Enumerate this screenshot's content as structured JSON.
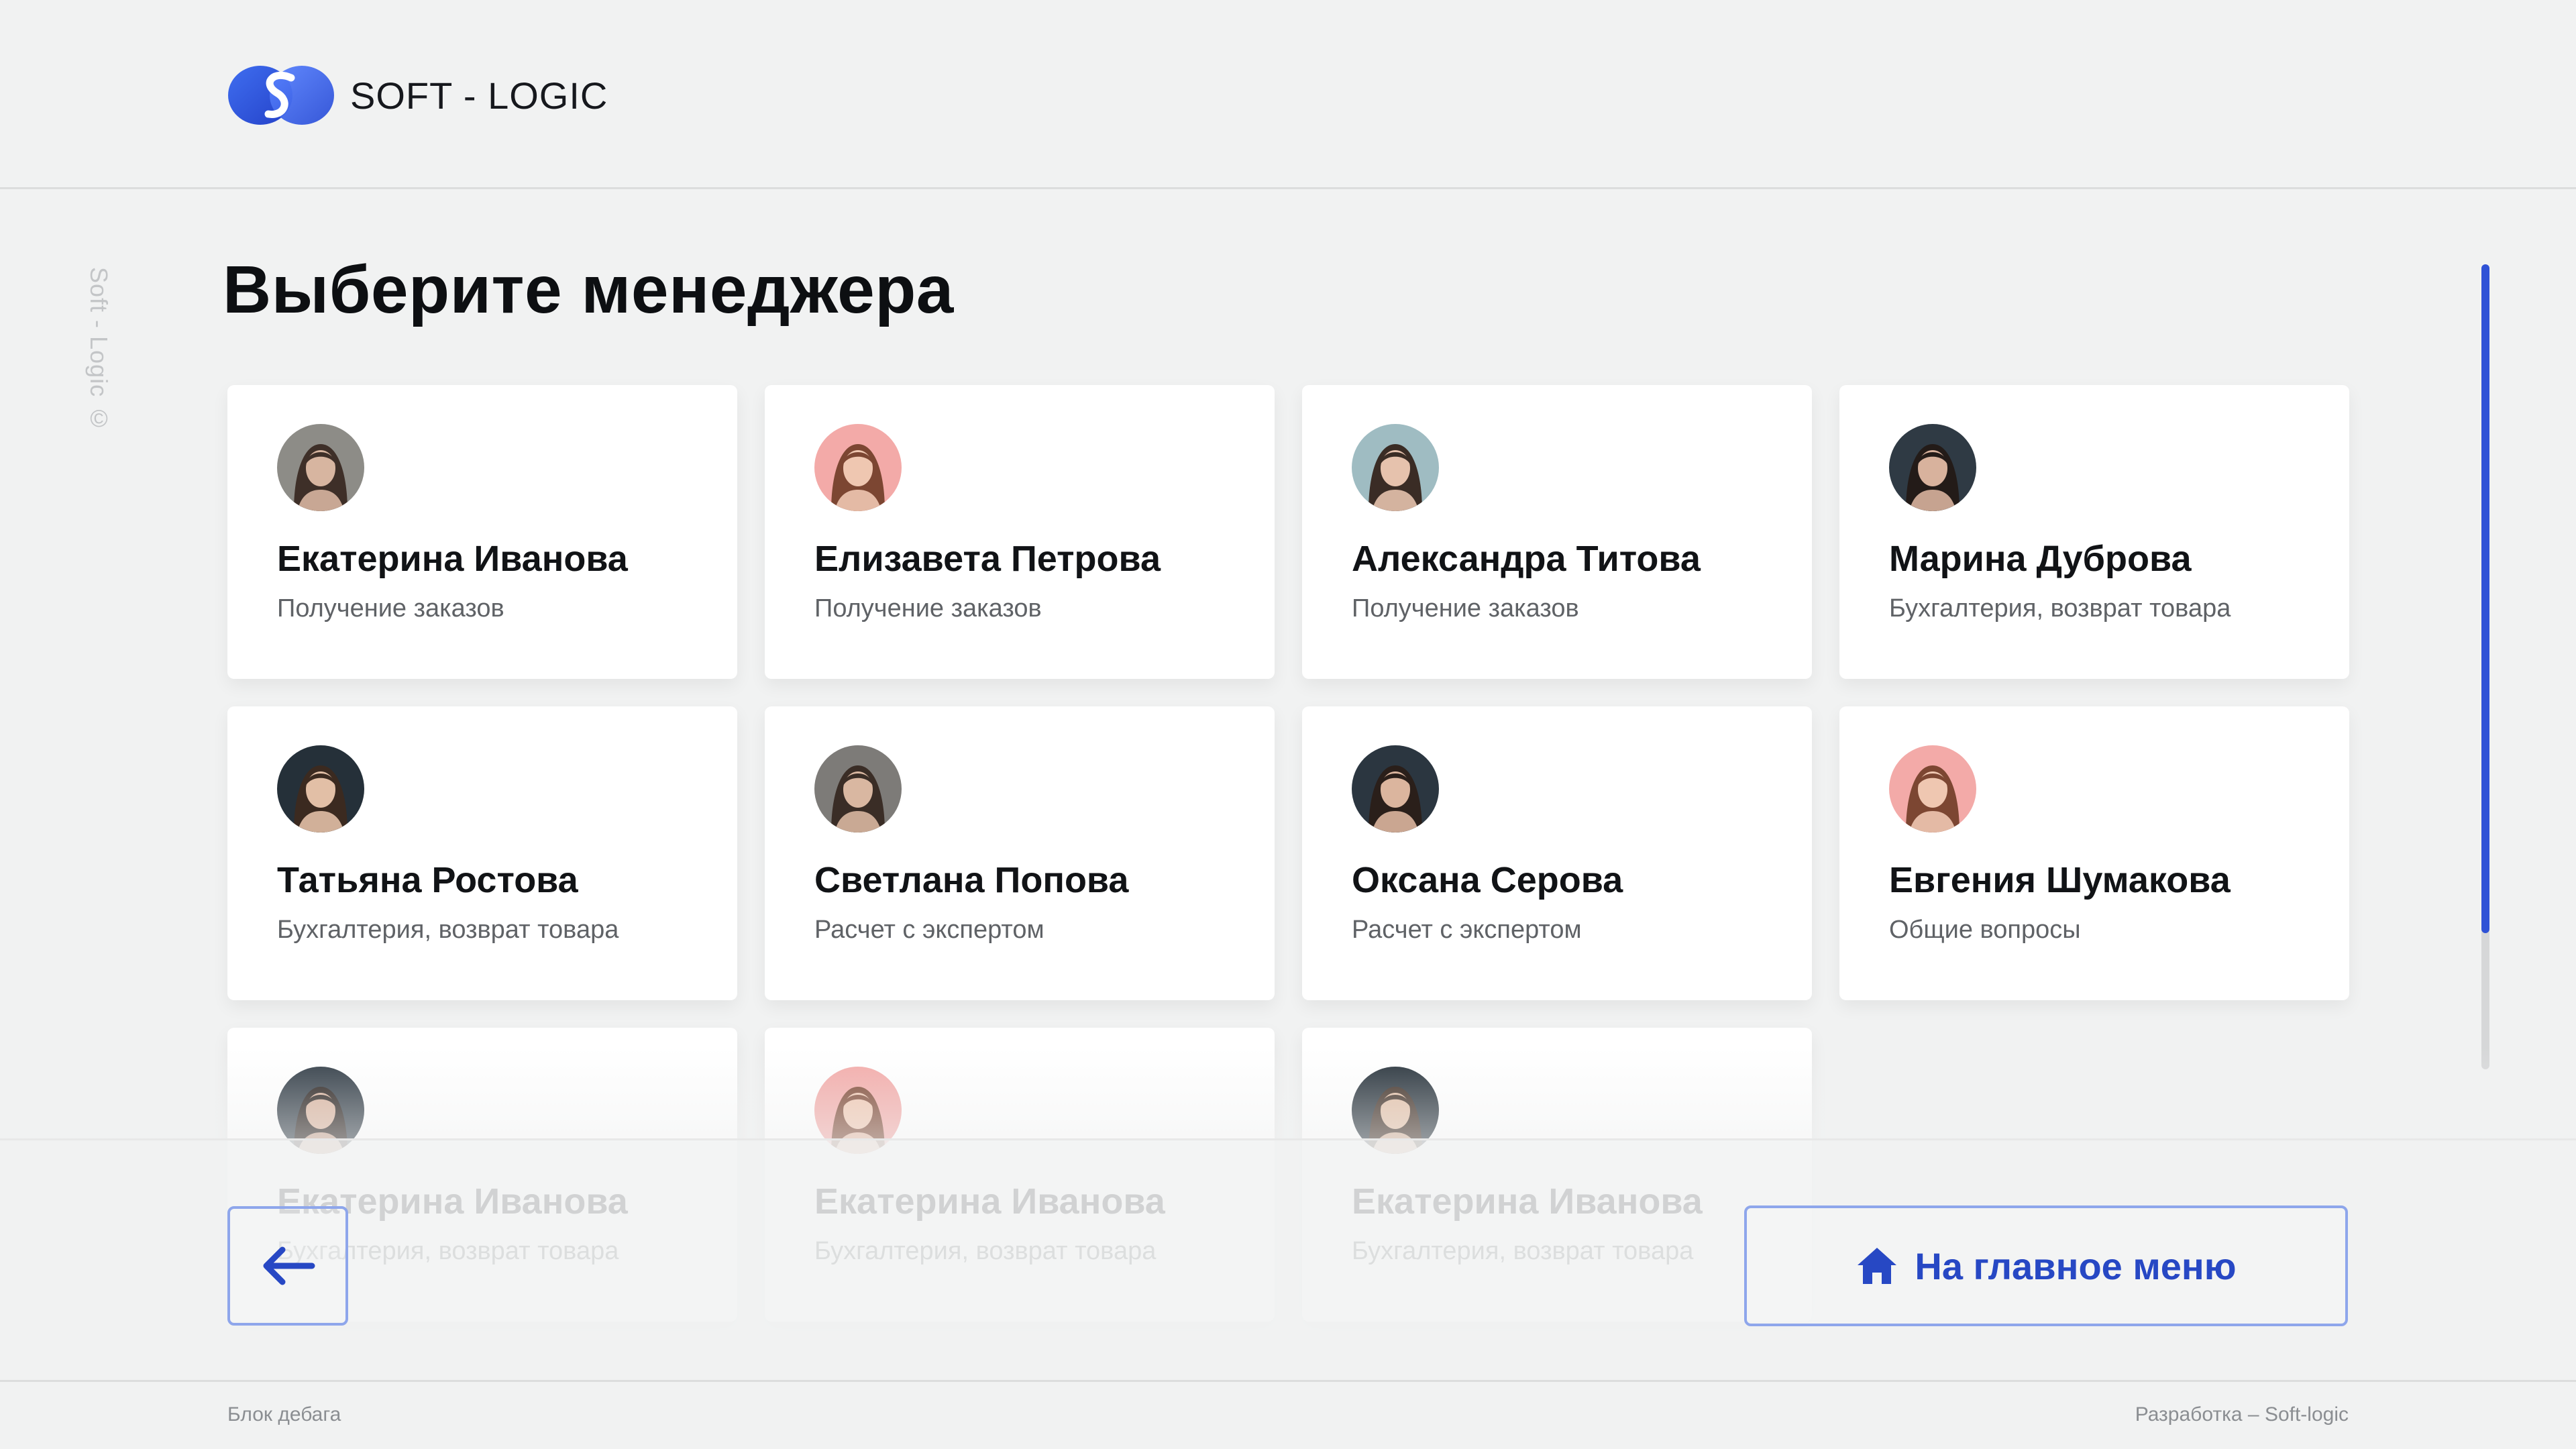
{
  "header": {
    "brand": "SOFT - LOGIC"
  },
  "side": {
    "copyright": "Soft - Logic ©"
  },
  "main": {
    "title": "Выберите менеджера"
  },
  "managers": [
    {
      "name": "Екатерина Иванова",
      "role": "Получение заказов",
      "avatar_bg": "#8d8c87",
      "hair": "#3e2f28",
      "skin": "#d7b5a0"
    },
    {
      "name": "Елизавета Петрова",
      "role": "Получение заказов",
      "avatar_bg": "#f3aaa8",
      "hair": "#7c4632",
      "skin": "#efc7b1"
    },
    {
      "name": "Александра Титова",
      "role": "Получение заказов",
      "avatar_bg": "#9fbcc2",
      "hair": "#3a2c25",
      "skin": "#e6c2ad"
    },
    {
      "name": "Марина Дуброва",
      "role": "Бухгалтерия, возврат товара",
      "avatar_bg": "#2f3a44",
      "hair": "#231b18",
      "skin": "#d8b29d"
    },
    {
      "name": "Татьяна Ростова",
      "role": "Бухгалтерия, возврат товара",
      "avatar_bg": "#253039",
      "hair": "#3b2a20",
      "skin": "#e2bfa6"
    },
    {
      "name": "Светлана Попова",
      "role": "Расчет с экспертом",
      "avatar_bg": "#7d7b78",
      "hair": "#3a2d26",
      "skin": "#d9b7a1"
    },
    {
      "name": "Оксана Серова",
      "role": "Расчет с экспертом",
      "avatar_bg": "#2b3640",
      "hair": "#2a1f1a",
      "skin": "#dbb59e"
    },
    {
      "name": "Евгения Шумакова",
      "role": "Общие вопросы",
      "avatar_bg": "#f3aaa8",
      "hair": "#7c4632",
      "skin": "#efc7b1"
    },
    {
      "name": "Екатерина Иванова",
      "role": "Бухгалтерия, возврат товара",
      "avatar_bg": "#2f3a44",
      "hair": "#231b18",
      "skin": "#d8b29d"
    },
    {
      "name": "Екатерина Иванова",
      "role": "Бухгалтерия, возврат товара",
      "avatar_bg": "#f3aaa8",
      "hair": "#7c4632",
      "skin": "#efc7b1"
    },
    {
      "name": "Екатерина Иванова",
      "role": "Бухгалтерия, возврат товара",
      "avatar_bg": "#253039",
      "hair": "#3b2a20",
      "skin": "#e2bfa6"
    }
  ],
  "navigation": {
    "home_label": "На главное меню"
  },
  "footer": {
    "left": "Блок дебага",
    "right": "Разработка – Soft-logic"
  },
  "colors": {
    "accent": "#2f52d6",
    "button_border": "#8ea6eb",
    "background": "#f1f2f2"
  },
  "icons": {
    "back": "arrow-left-icon",
    "home": "home-icon"
  }
}
